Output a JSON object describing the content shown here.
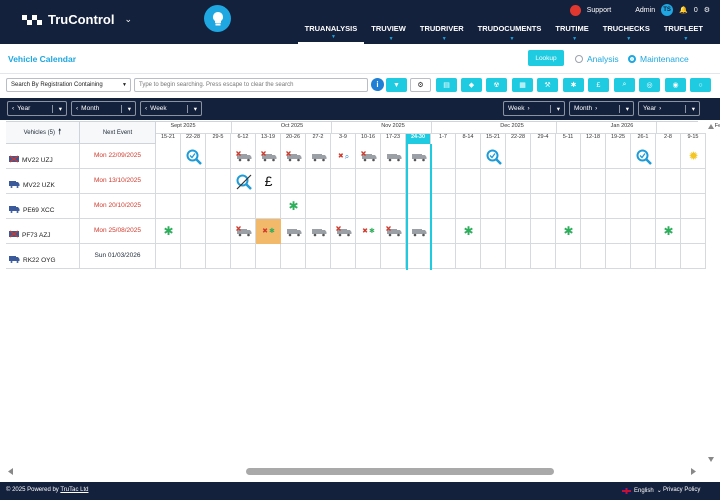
{
  "app": {
    "brand": "TruControl",
    "support": "Support",
    "user_menu": "Admin",
    "avatar_initials": "TS",
    "notifications": "0",
    "colors": {
      "navy": "#14213d",
      "accent": "#1ea7e1",
      "cyan": "#1ecbe1",
      "red": "#d0392b",
      "green": "#2dae5b"
    }
  },
  "nav": {
    "tabs": [
      "TRUANALYSIS",
      "TRUVIEW",
      "TRUDRIVER",
      "TRUDOCUMENTS",
      "TRUTIME",
      "TRUCHECKS",
      "TRUFLEET"
    ],
    "active": "TRUANALYSIS"
  },
  "page": {
    "title": "Vehicle Calendar",
    "lookup_label": "Lookup",
    "radio_analysis": "Analysis",
    "radio_maintenance": "Maintenance",
    "radio_selected": "Maintenance"
  },
  "search": {
    "mode": "Search By Registration Containing",
    "placeholder": "Type to begin searching. Press escape to clear the search",
    "toolbar_icons": [
      "filter-icon",
      "settings-icon",
      "document-icon",
      "shield-icon",
      "radiation-icon",
      "calendar-icon",
      "wrench-icon",
      "snowflake-icon",
      "pound-icon",
      "search-icon",
      "tyre-icon",
      "target-icon",
      "circle-icon"
    ]
  },
  "calendar_nav": {
    "prev_year": "Year",
    "prev_month": "Month",
    "prev_week": "Week",
    "next_week": "Week",
    "next_month": "Month",
    "next_year": "Year"
  },
  "grid": {
    "col_vehicles": "Vehicles (5)",
    "col_next_event": "Next Event",
    "months": [
      {
        "label": "Sept 2025"
      },
      {
        "label": "Oct 2025"
      },
      {
        "label": "Nov 2025"
      },
      {
        "label": "Dec 2025"
      },
      {
        "label": "Jan 2026"
      },
      {
        "label": "Fe"
      }
    ],
    "weeks": [
      "15-21",
      "22-28",
      "29-5",
      "6-12",
      "13-19",
      "20-26",
      "27-2",
      "3-9",
      "10-16",
      "17-23",
      "24-30",
      "1-7",
      "8-14",
      "15-21",
      "22-28",
      "29-4",
      "5-11",
      "12-18",
      "19-25",
      "26-1",
      "2-8",
      "9-15"
    ],
    "current_week": "24-30",
    "rows": [
      {
        "reg": "MV22 UZJ",
        "next_event": "Mon 22/09/2025",
        "overdue": true,
        "vehicle_icon": "van-x-icon",
        "events": [
          {
            "w": 1,
            "icon": "inspection-icon"
          },
          {
            "w": 3,
            "icon": "van-x-icon"
          },
          {
            "w": 4,
            "icon": "van-x-icon"
          },
          {
            "w": 5,
            "icon": "van-x-icon"
          },
          {
            "w": 6,
            "icon": "van-icon"
          },
          {
            "w": 7,
            "icon": "van-x-search-icon"
          },
          {
            "w": 8,
            "icon": "van-x-icon"
          },
          {
            "w": 9,
            "icon": "van-icon"
          },
          {
            "w": 10,
            "icon": "van-icon"
          },
          {
            "w": 13,
            "icon": "inspection-icon"
          },
          {
            "w": 19,
            "icon": "inspection-icon"
          },
          {
            "w": 21,
            "icon": "sun-icon"
          }
        ]
      },
      {
        "reg": "MV22 UZK",
        "next_event": "Mon 13/10/2025",
        "overdue": true,
        "vehicle_icon": "van-icon",
        "events": [
          {
            "w": 3,
            "icon": "inspection-cancelled-icon"
          },
          {
            "w": 4,
            "icon": "pound-icon"
          }
        ]
      },
      {
        "reg": "PE69 XCC",
        "next_event": "Mon 20/10/2025",
        "overdue": true,
        "vehicle_icon": "van-icon",
        "events": [
          {
            "w": 5,
            "icon": "snowflake-icon"
          }
        ]
      },
      {
        "reg": "PF73 AZJ",
        "next_event": "Mon 25/08/2025",
        "overdue": true,
        "vehicle_icon": "van-x-icon",
        "events": [
          {
            "w": 0,
            "icon": "snowflake-icon"
          },
          {
            "w": 3,
            "icon": "van-x-icon"
          },
          {
            "w": 4,
            "icon": "van-x-snow-icon",
            "highlight": true
          },
          {
            "w": 5,
            "icon": "van-icon"
          },
          {
            "w": 6,
            "icon": "van-icon"
          },
          {
            "w": 7,
            "icon": "van-x-icon"
          },
          {
            "w": 8,
            "icon": "van-x-snow-icon"
          },
          {
            "w": 9,
            "icon": "van-x-icon"
          },
          {
            "w": 10,
            "icon": "van-icon"
          },
          {
            "w": 12,
            "icon": "snowflake-icon"
          },
          {
            "w": 16,
            "icon": "snowflake-icon"
          },
          {
            "w": 20,
            "icon": "snowflake-icon"
          }
        ]
      },
      {
        "reg": "RK22 OYG",
        "next_event": "Sun 01/03/2026",
        "overdue": false,
        "vehicle_icon": "van-icon",
        "events": []
      }
    ]
  },
  "footer": {
    "copyright": "© 2025 Powered by",
    "company": "TruTac Ltd",
    "language": "English",
    "privacy": "Privacy Policy"
  }
}
